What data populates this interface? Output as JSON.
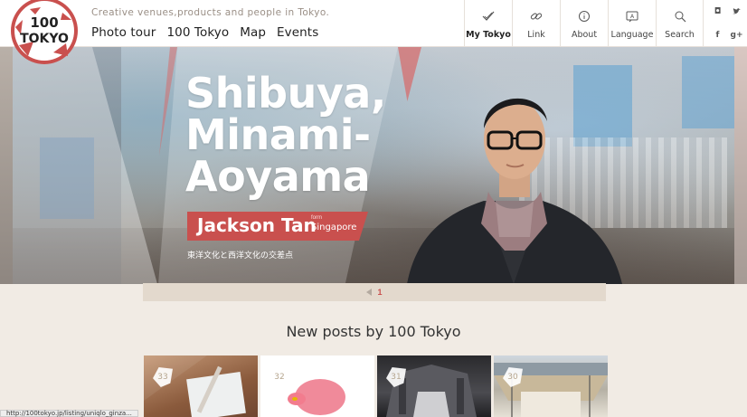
{
  "header": {
    "logo_text": "100 TOKYO",
    "tagline": "Creative venues,products and people in Tokyo.",
    "nav": [
      "Photo tour",
      "100 Tokyo",
      "Map",
      "Events"
    ],
    "icon_nav": [
      {
        "label": "My Tokyo",
        "icon": "check-icon"
      },
      {
        "label": "Link",
        "icon": "link-icon"
      },
      {
        "label": "About",
        "icon": "info-icon"
      },
      {
        "label": "Language",
        "icon": "language-icon"
      },
      {
        "label": "Search",
        "icon": "search-icon"
      }
    ],
    "social": [
      "instagram-icon",
      "twitter-icon",
      "facebook-icon",
      "google-plus-icon"
    ],
    "social_glyphs": [
      "◘",
      "🐦",
      "f",
      "g+"
    ]
  },
  "hero": {
    "title_lines": [
      "Shibuya,",
      "Minami-",
      "Aoyama"
    ],
    "name": "Jackson Tan",
    "from_label": "form",
    "from_place": "Singapore",
    "subtitle": "東洋文化と西洋文化の交差点",
    "accent_color": "#c9504e"
  },
  "pager": {
    "current": "1"
  },
  "section_title": "New posts by 100 Tokyo",
  "posts": [
    {
      "number": "33"
    },
    {
      "number": "32"
    },
    {
      "number": "31"
    },
    {
      "number": "30"
    }
  ],
  "status_bar": "http://100tokyo.jp/listing/uniqlo_ginza..."
}
